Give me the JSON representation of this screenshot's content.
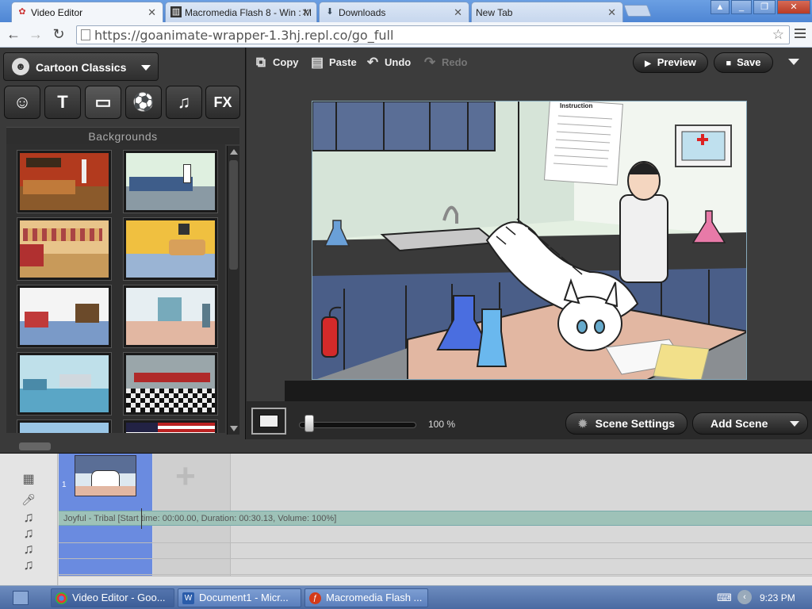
{
  "browser": {
    "tabs": [
      {
        "title": "Video Editor",
        "icon": "cartoon-icon",
        "active": true
      },
      {
        "title": "Macromedia Flash 8 - Win : M",
        "icon": "flash-doc-icon",
        "active": false
      },
      {
        "title": "Downloads",
        "icon": "download-icon",
        "active": false
      },
      {
        "title": "New Tab",
        "icon": "",
        "active": false
      }
    ],
    "url": "https://goanimate-wrapper-1.3hj.repl.co/go_full"
  },
  "left_panel": {
    "theme_label": "Cartoon Classics",
    "category_tabs": [
      {
        "name": "characters",
        "glyph": "☺"
      },
      {
        "name": "text-bubbles",
        "glyph": "T"
      },
      {
        "name": "backgrounds",
        "glyph": "▭"
      },
      {
        "name": "props",
        "glyph": "⚽"
      },
      {
        "name": "music",
        "glyph": "♫"
      },
      {
        "name": "effects",
        "glyph": "FX"
      }
    ],
    "section_title": "Backgrounds"
  },
  "stage_toolbar": {
    "copy_label": "Copy",
    "paste_label": "Paste",
    "undo_label": "Undo",
    "redo_label": "Redo",
    "preview_label": "Preview",
    "save_label": "Save"
  },
  "stage": {
    "poster_title": "Instruction",
    "zoom": "100 %",
    "scene_settings_label": "Scene Settings",
    "add_scene_label": "Add Scene"
  },
  "timeline": {
    "scene_number": "1",
    "audio_track": "Joyful - Tribal [Start time: 00:00.00, Duration: 00:30.13, Volume: 100%]"
  },
  "taskbar": {
    "items": [
      {
        "label": "Video Editor - Goo...",
        "icon": "chrome-icon"
      },
      {
        "label": "Document1 - Micr...",
        "icon": "word-icon"
      },
      {
        "label": "Macromedia Flash ...",
        "icon": "flash-icon"
      }
    ],
    "clock": "9:23 PM"
  },
  "colors": {
    "accent_blue": "#6a8be0",
    "audio_track": "#9ec2b8",
    "panel_dark": "#3a3a3a"
  }
}
